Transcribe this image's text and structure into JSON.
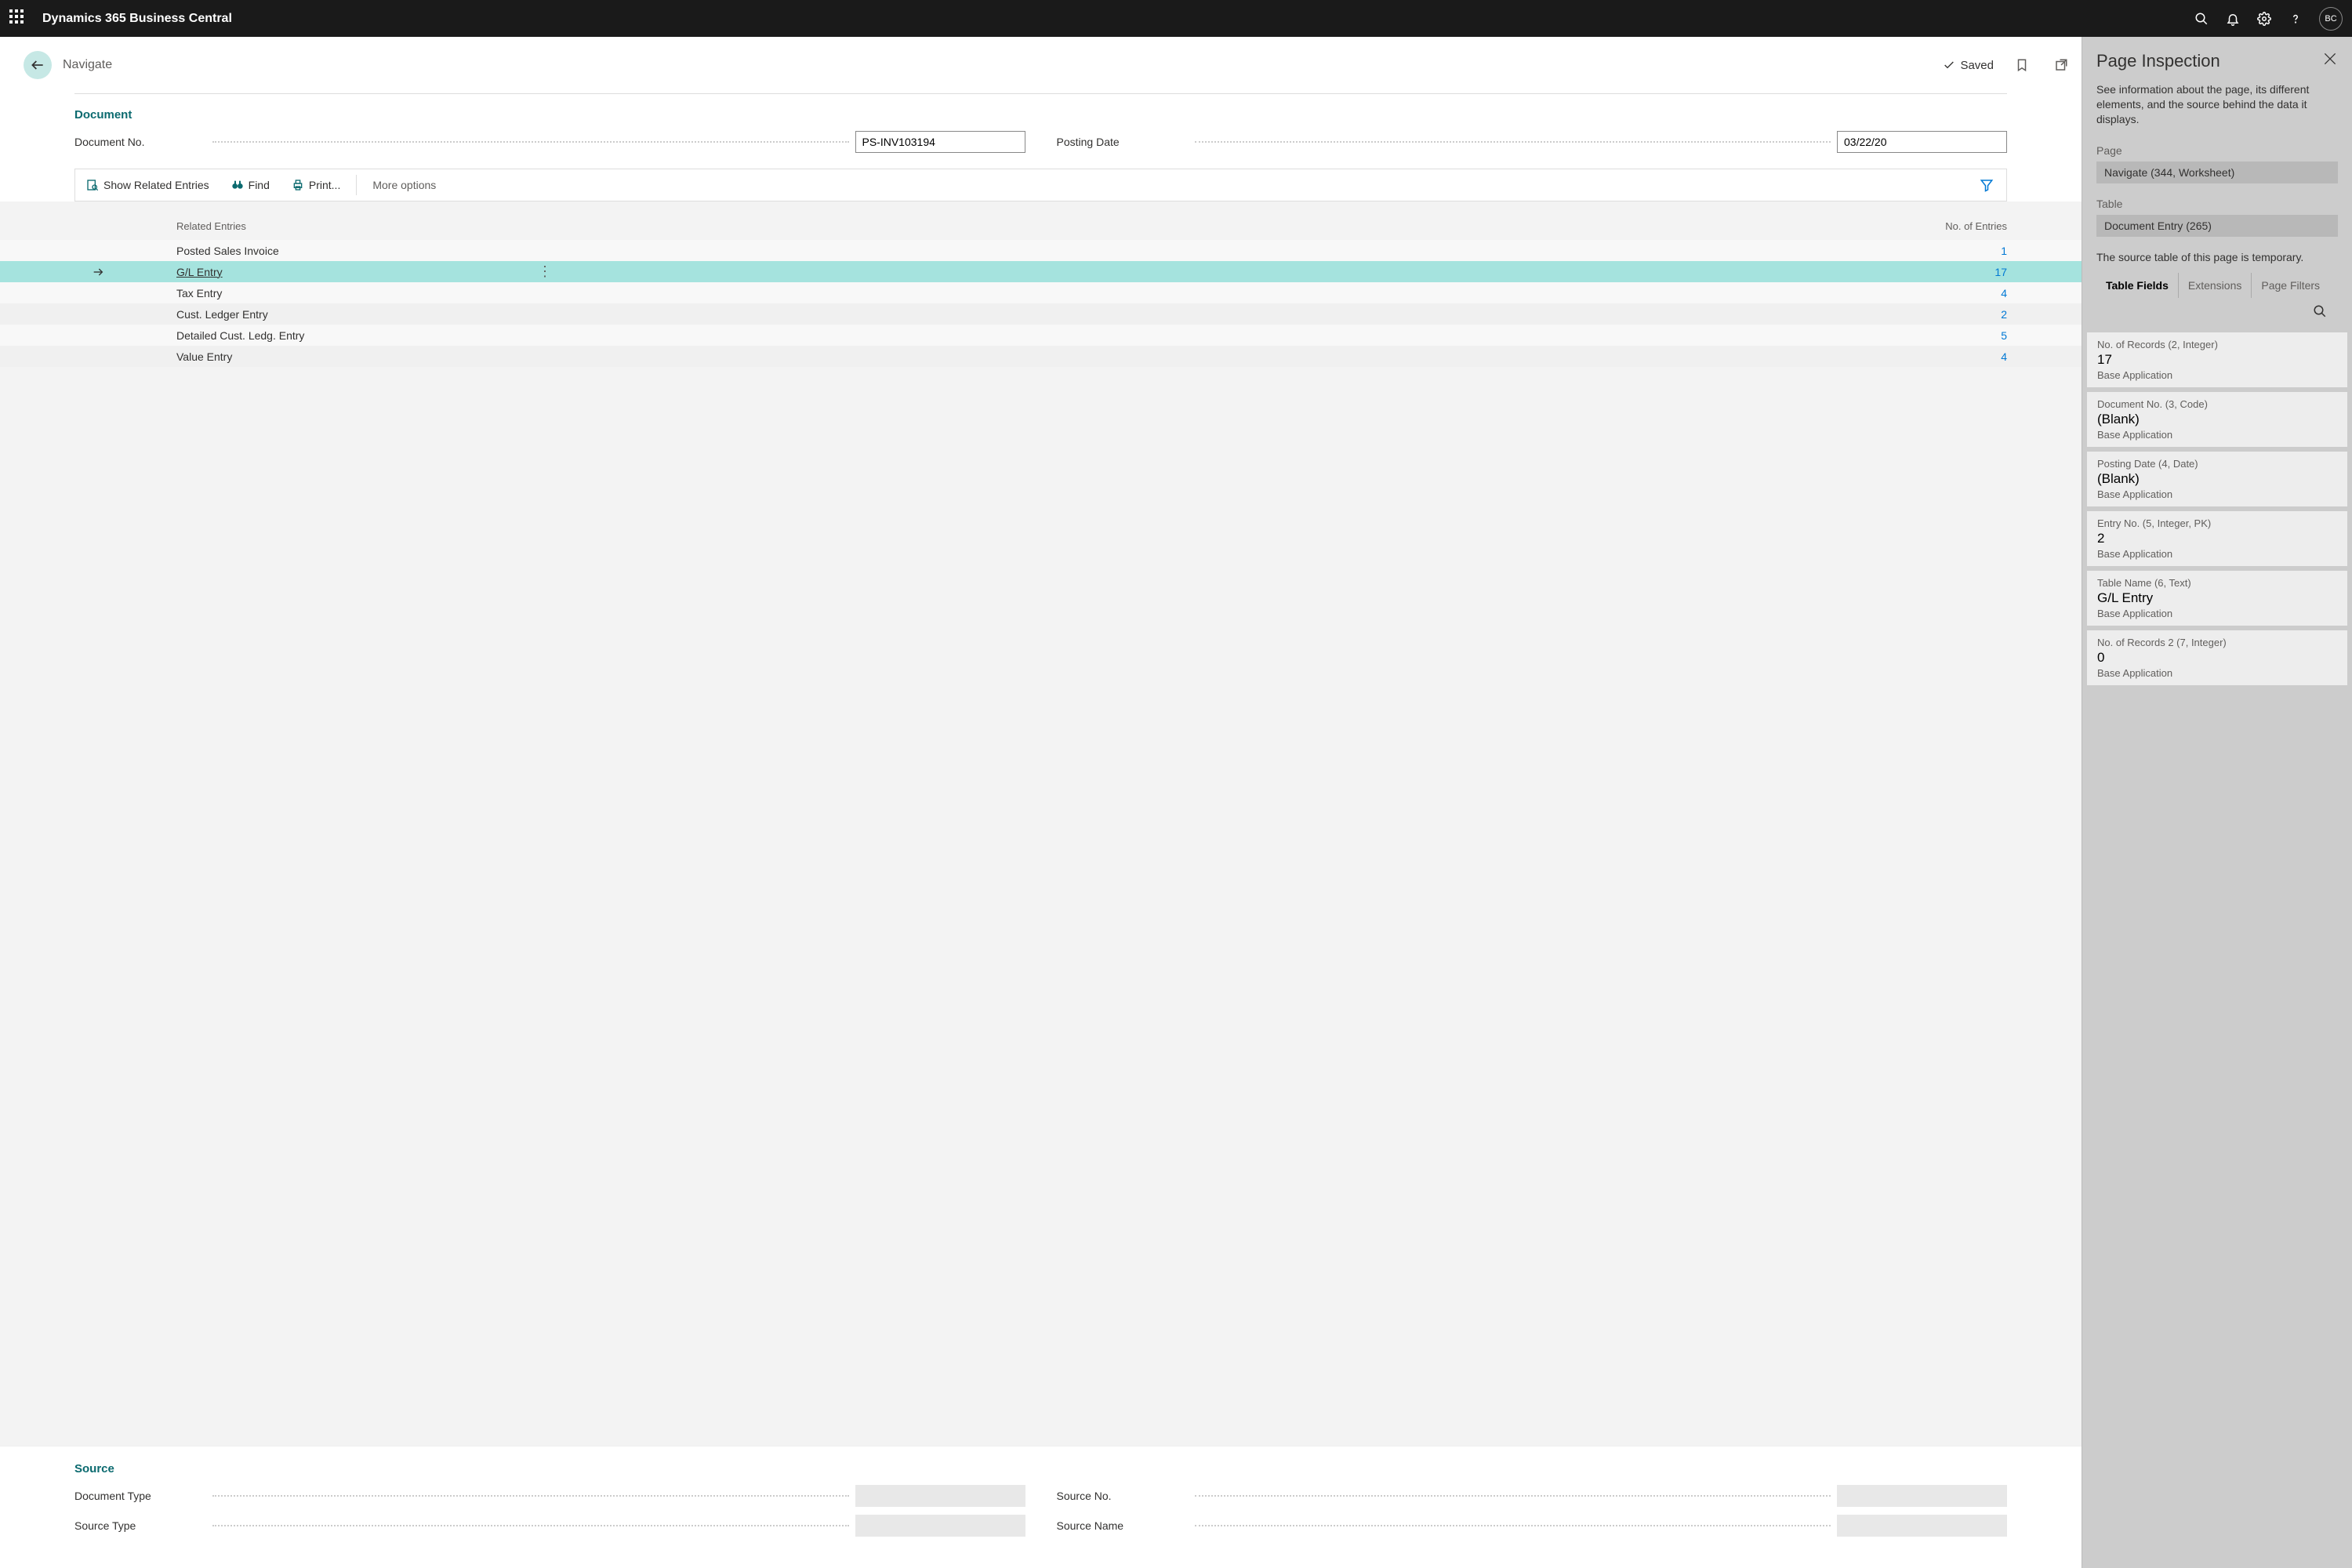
{
  "topbar": {
    "app_title": "Dynamics 365 Business Central",
    "avatar_initials": "BC"
  },
  "page": {
    "title": "Navigate",
    "saved_label": "Saved"
  },
  "document": {
    "section_title": "Document",
    "doc_no_label": "Document No.",
    "doc_no_value": "PS-INV103194",
    "posting_date_label": "Posting Date",
    "posting_date_value": "03/22/20"
  },
  "toolbar": {
    "show_related": "Show Related Entries",
    "find": "Find",
    "print": "Print...",
    "more": "More options"
  },
  "table": {
    "header_entries": "Related Entries",
    "header_count": "No. of Entries",
    "rows": [
      {
        "name": "Posted Sales Invoice",
        "count": "1"
      },
      {
        "name": "G/L Entry",
        "count": "17"
      },
      {
        "name": "Tax Entry",
        "count": "4"
      },
      {
        "name": "Cust. Ledger Entry",
        "count": "2"
      },
      {
        "name": "Detailed Cust. Ledg. Entry",
        "count": "5"
      },
      {
        "name": "Value Entry",
        "count": "4"
      }
    ]
  },
  "source": {
    "section_title": "Source",
    "doc_type_label": "Document Type",
    "source_type_label": "Source Type",
    "source_no_label": "Source No.",
    "source_name_label": "Source Name"
  },
  "inspector": {
    "title": "Page Inspection",
    "desc": "See information about the page, its different elements, and the source behind the data it displays.",
    "page_label": "Page",
    "page_value": "Navigate (344, Worksheet)",
    "table_label": "Table",
    "table_value": "Document Entry (265)",
    "note": "The source table of this page is temporary.",
    "tabs": {
      "fields": "Table Fields",
      "extensions": "Extensions",
      "filters": "Page Filters"
    },
    "fields": [
      {
        "meta": "No. of Records (2, Integer)",
        "val": "17",
        "src": "Base Application"
      },
      {
        "meta": "Document No. (3, Code)",
        "val": "(Blank)",
        "src": "Base Application"
      },
      {
        "meta": "Posting Date (4, Date)",
        "val": "(Blank)",
        "src": "Base Application"
      },
      {
        "meta": "Entry No. (5, Integer, PK)",
        "val": "2",
        "src": "Base Application"
      },
      {
        "meta": "Table Name (6, Text)",
        "val": "G/L Entry",
        "src": "Base Application"
      },
      {
        "meta": "No. of Records 2 (7, Integer)",
        "val": "0",
        "src": "Base Application"
      }
    ]
  }
}
